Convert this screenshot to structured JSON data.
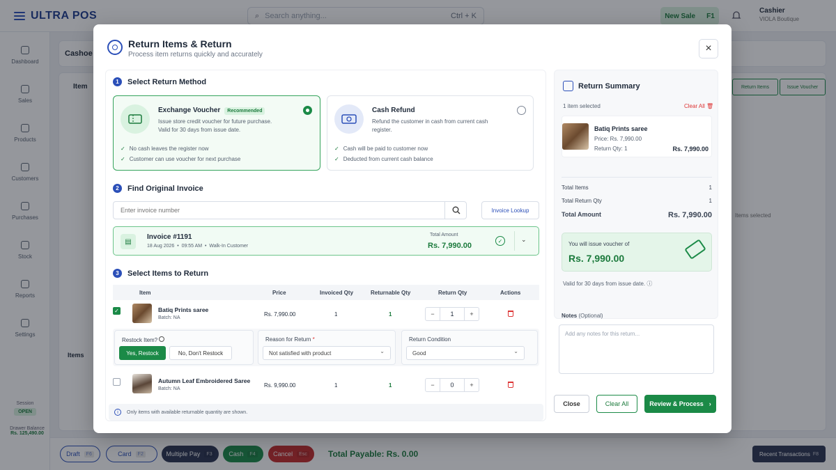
{
  "app": {
    "brand": "ULTRA POS",
    "search_placeholder": "Search anything...",
    "search_shortcut": "Ctrl + K",
    "new_sale": "New Sale",
    "new_sale_key": "F1",
    "cashier_role": "Cashier",
    "cashier_store": "VIOLA Boutique",
    "sidebar": [
      {
        "label": "Dashboard",
        "icon": "home-icon"
      },
      {
        "label": "Sales",
        "icon": "receipt-icon"
      },
      {
        "label": "Products",
        "icon": "box-icon"
      },
      {
        "label": "Customers",
        "icon": "users-icon"
      },
      {
        "label": "Purchases",
        "icon": "cart-icon"
      },
      {
        "label": "Stock",
        "icon": "stock-icon"
      },
      {
        "label": "Reports",
        "icon": "chart-icon"
      },
      {
        "label": "Settings",
        "icon": "gear-icon"
      }
    ],
    "session_label": "Session",
    "session_status": "OPEN",
    "drawer_label": "Drawer Balance",
    "drawer_value": "Rs. 125,490.00",
    "bg_heading": "Cashoe",
    "bg_item_col": "Item",
    "bg_items": "Items",
    "bg_return_items": "Return Items",
    "bg_issue_voucher": "Issue Voucher",
    "bg_empty": "Items selected",
    "bottom": {
      "draft": "Draft",
      "draft_key": "F6",
      "card": "Card",
      "card_key": "F2",
      "multi": "Multiple Pay",
      "multi_key": "F3",
      "cash": "Cash",
      "cash_key": "F4",
      "cancel": "Cancel",
      "cancel_key": "Esc",
      "total": "Total Payable: Rs. 0.00",
      "recent": "Recent Transactions",
      "recent_key": "F8"
    }
  },
  "modal": {
    "title": "Return Items & Return",
    "subtitle": "Process item returns quickly and accurately",
    "close_icon": "close-icon",
    "step1": {
      "num": "1",
      "title": "Select Return Method"
    },
    "methods": [
      {
        "title": "Exchange Voucher",
        "badge": "Recommended",
        "desc": "Issue store credit voucher for future purchase. Valid for 30 days from issue date.",
        "points": [
          "No cash leaves the register now",
          "Customer can use voucher for next purchase"
        ],
        "selected": true
      },
      {
        "title": "Cash Refund",
        "desc": "Refund the customer in cash from current cash register.",
        "points": [
          "Cash will be paid to customer now",
          "Deducted from current cash balance"
        ],
        "selected": false
      }
    ],
    "step2": {
      "num": "2",
      "title": "Find Original Invoice"
    },
    "invoice_placeholder": "Enter invoice number",
    "invoice_lookup": "Invoice Lookup",
    "invoice": {
      "number": "Invoice #1191",
      "date": "18 Aug 2026",
      "time": "09:55 AM",
      "customer": "Walk-In Customer",
      "total_label": "Total Amount",
      "total": "Rs. 7,990.00"
    },
    "step3": {
      "num": "3",
      "title": "Select Items to Return"
    },
    "columns": [
      "Item",
      "Price",
      "Invoiced Qty",
      "Returnable Qty",
      "Return Qty",
      "Actions"
    ],
    "items": [
      {
        "name": "Batiq Prints saree",
        "batch": "Batch: NA",
        "price": "Rs. 7,990.00",
        "invoiced": "1",
        "returnable": "1",
        "return_qty": "1",
        "checked": true
      },
      {
        "name": "Autumn Leaf Embroidered Saree",
        "batch": "Batch: NA",
        "price": "Rs. 9,990.00",
        "invoiced": "1",
        "returnable": "1",
        "return_qty": "0",
        "checked": false
      }
    ],
    "restock": {
      "label": "Restock Item?",
      "yes": "Yes, Restock",
      "no": "No, Don't Restock",
      "reason_label": "Reason for Return",
      "reason_required": "*",
      "reason_value": "Not satisfied with product",
      "condition_label": "Return Condition",
      "condition_value": "Good"
    },
    "footnote": "Only items with available returnable quantity are shown.",
    "summary": {
      "title": "Return Summary",
      "count": "1 item selected",
      "clear_all": "Clear All",
      "item_name": "Batiq Prints saree",
      "item_price": "Price: Rs. 7,990.00",
      "item_qty": "Return Qty: 1",
      "item_amount": "Rs. 7,990.00",
      "rows": [
        {
          "label": "Total Items",
          "value": "1"
        },
        {
          "label": "Total Return Qty",
          "value": "1"
        }
      ],
      "total_label": "Total Amount",
      "total_value": "Rs. 7,990.00",
      "voucher_label": "You will issue voucher of",
      "voucher_amount": "Rs. 7,990.00",
      "valid_note": "Valid for 30 days from issue date."
    },
    "notes_label": "Notes",
    "notes_optional": "(Optional)",
    "notes_placeholder": "Add any notes for this return...",
    "buttons": {
      "close": "Close",
      "clear": "Clear All",
      "process": "Review & Process"
    }
  }
}
